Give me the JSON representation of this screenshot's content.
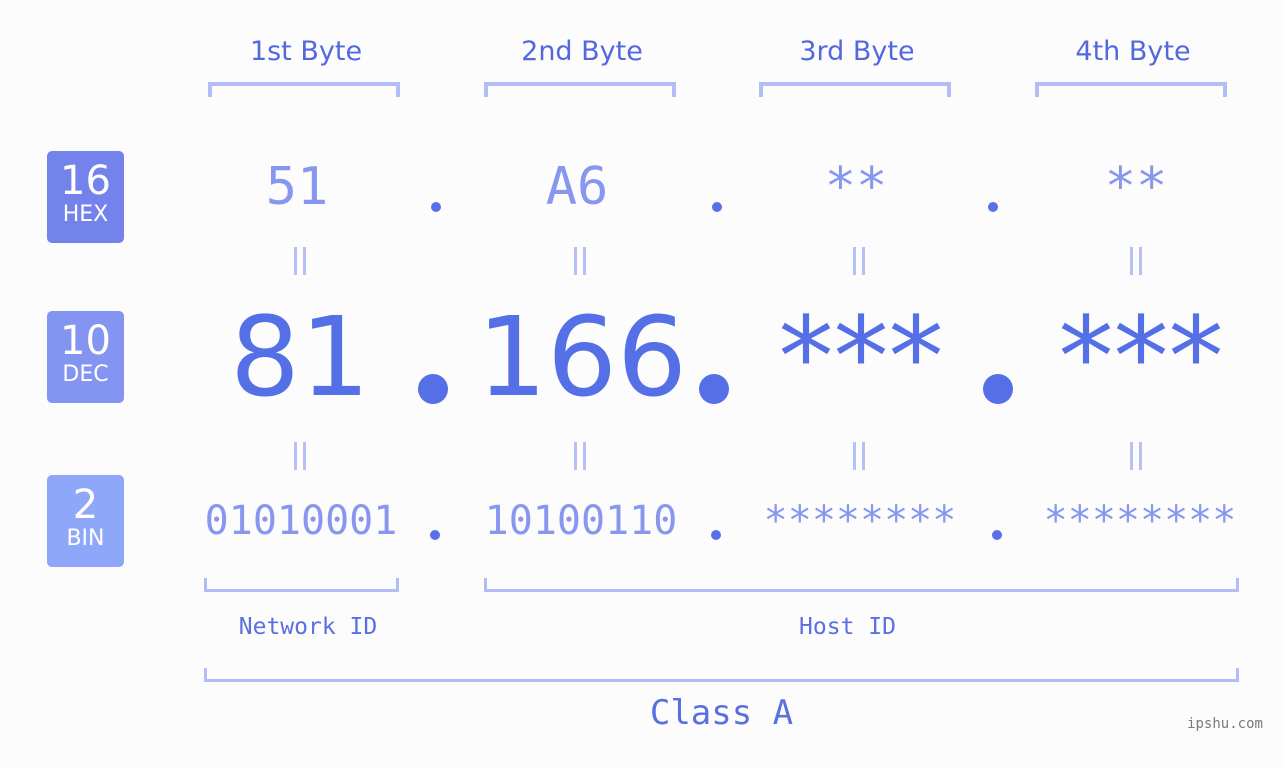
{
  "badges": [
    {
      "number": "16",
      "label": "HEX"
    },
    {
      "number": "10",
      "label": "DEC"
    },
    {
      "number": "2",
      "label": "BIN"
    }
  ],
  "byte_headers": [
    "1st Byte",
    "2nd Byte",
    "3rd Byte",
    "4th Byte"
  ],
  "hex": [
    "51",
    "A6",
    "**",
    "**"
  ],
  "dec": [
    "81",
    "166",
    "***",
    "***"
  ],
  "bin": [
    "01010001",
    "10100110",
    "********",
    "********"
  ],
  "labels": {
    "network_id": "Network ID",
    "host_id": "Host ID",
    "class": "Class A"
  },
  "watermark": "ipshu.com",
  "colors": {
    "hex_badge": "#7383eb",
    "dec_badge": "#8394f1",
    "bin_badge": "#8ea7f9",
    "accent": "#5570e6",
    "bracket": "#b2bcf7"
  }
}
